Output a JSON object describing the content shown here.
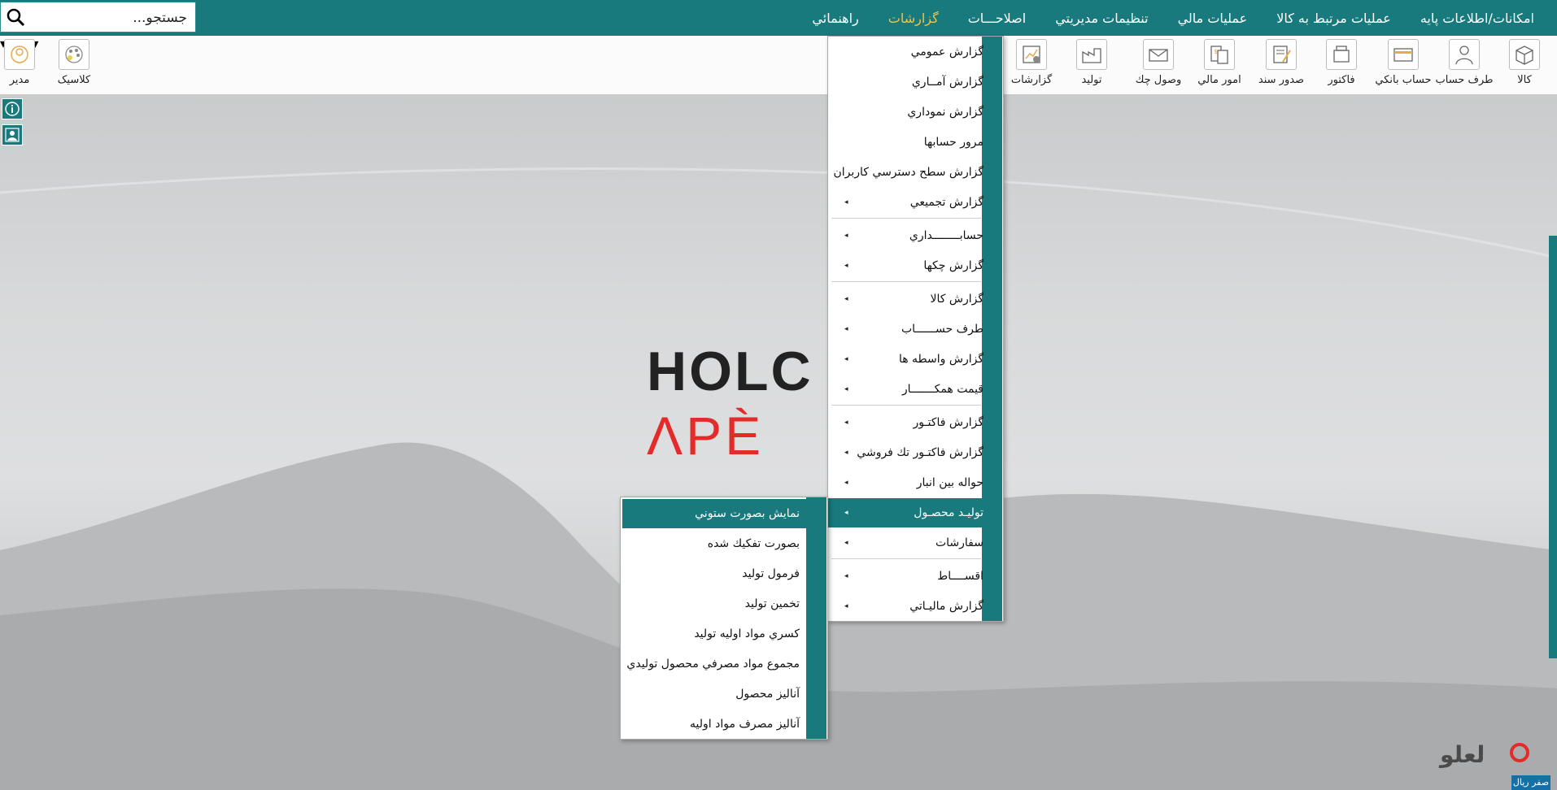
{
  "menubar": {
    "items": [
      "امکانات/اطلاعات پايه",
      "عمليات مرتبط به کالا",
      "عمليات مالي",
      "تنظيمات مديريتي",
      "اصلاحـــات",
      "گزارشات",
      "راهنمائي"
    ],
    "active_index": 5
  },
  "search": {
    "placeholder": "جستجو..."
  },
  "toolbar": {
    "items": [
      "کالا",
      "طرف حساب",
      "حساب بانکي",
      "فاکتور",
      "صدور سند",
      "امور مالي",
      "وصول چك",
      "توليد",
      "گزارشات",
      "کلاسيک",
      "مدير"
    ]
  },
  "background": {
    "logo_line1": "HOLC",
    "logo_line2": "ΛPÈ"
  },
  "brand": {
    "name": "لعلو",
    "status": "صفر ريال"
  },
  "reports_menu": {
    "items": [
      {
        "label": "گزارش عمومي",
        "has_submenu": false
      },
      {
        "label": "گزارش آمــاري",
        "has_submenu": false
      },
      {
        "label": "گزارش نموداري",
        "has_submenu": false
      },
      {
        "label": "مرور حسابها",
        "has_submenu": false
      },
      {
        "label": "گزارش سطح دسترسي کاربران",
        "has_submenu": false
      },
      {
        "label": "گزارش تجميعي",
        "has_submenu": true
      },
      {
        "label": "حسابــــــــداري",
        "has_submenu": true
      },
      {
        "label": "گزارش چکها",
        "has_submenu": true
      },
      {
        "label": "گزارش کالا",
        "has_submenu": true
      },
      {
        "label": "طرف حســــــاب",
        "has_submenu": true
      },
      {
        "label": "گزارش واسطه ها",
        "has_submenu": true
      },
      {
        "label": "قيمت همکـــــــار",
        "has_submenu": true
      },
      {
        "label": "گزارش فاکتـور",
        "has_submenu": true
      },
      {
        "label": "گزارش فاکتـور تك فروشي",
        "has_submenu": true
      },
      {
        "label": "حواله بين انبار",
        "has_submenu": true
      },
      {
        "label": "توليـد محصـول",
        "has_submenu": true
      },
      {
        "label": "سفارشات",
        "has_submenu": true
      },
      {
        "label": "اقســــاط",
        "has_submenu": true
      },
      {
        "label": "گزارش ماليـاتي",
        "has_submenu": true
      }
    ],
    "highlighted_index": 15
  },
  "production_submenu": {
    "items": [
      "نمايش بصورت ستوني",
      "بصورت تفکيك شده",
      "فرمول توليد",
      "تخمين توليد",
      "کسري مواد اوليه توليد",
      "مجموع مواد مصرفي محصول توليدي",
      "آناليز محصول",
      "آناليز مصرف مواد اوليه"
    ],
    "highlighted_index": 0
  },
  "colors": {
    "teal": "#187a7d",
    "active_menu": "#f6c342",
    "logo_red": "#e52a2a"
  }
}
